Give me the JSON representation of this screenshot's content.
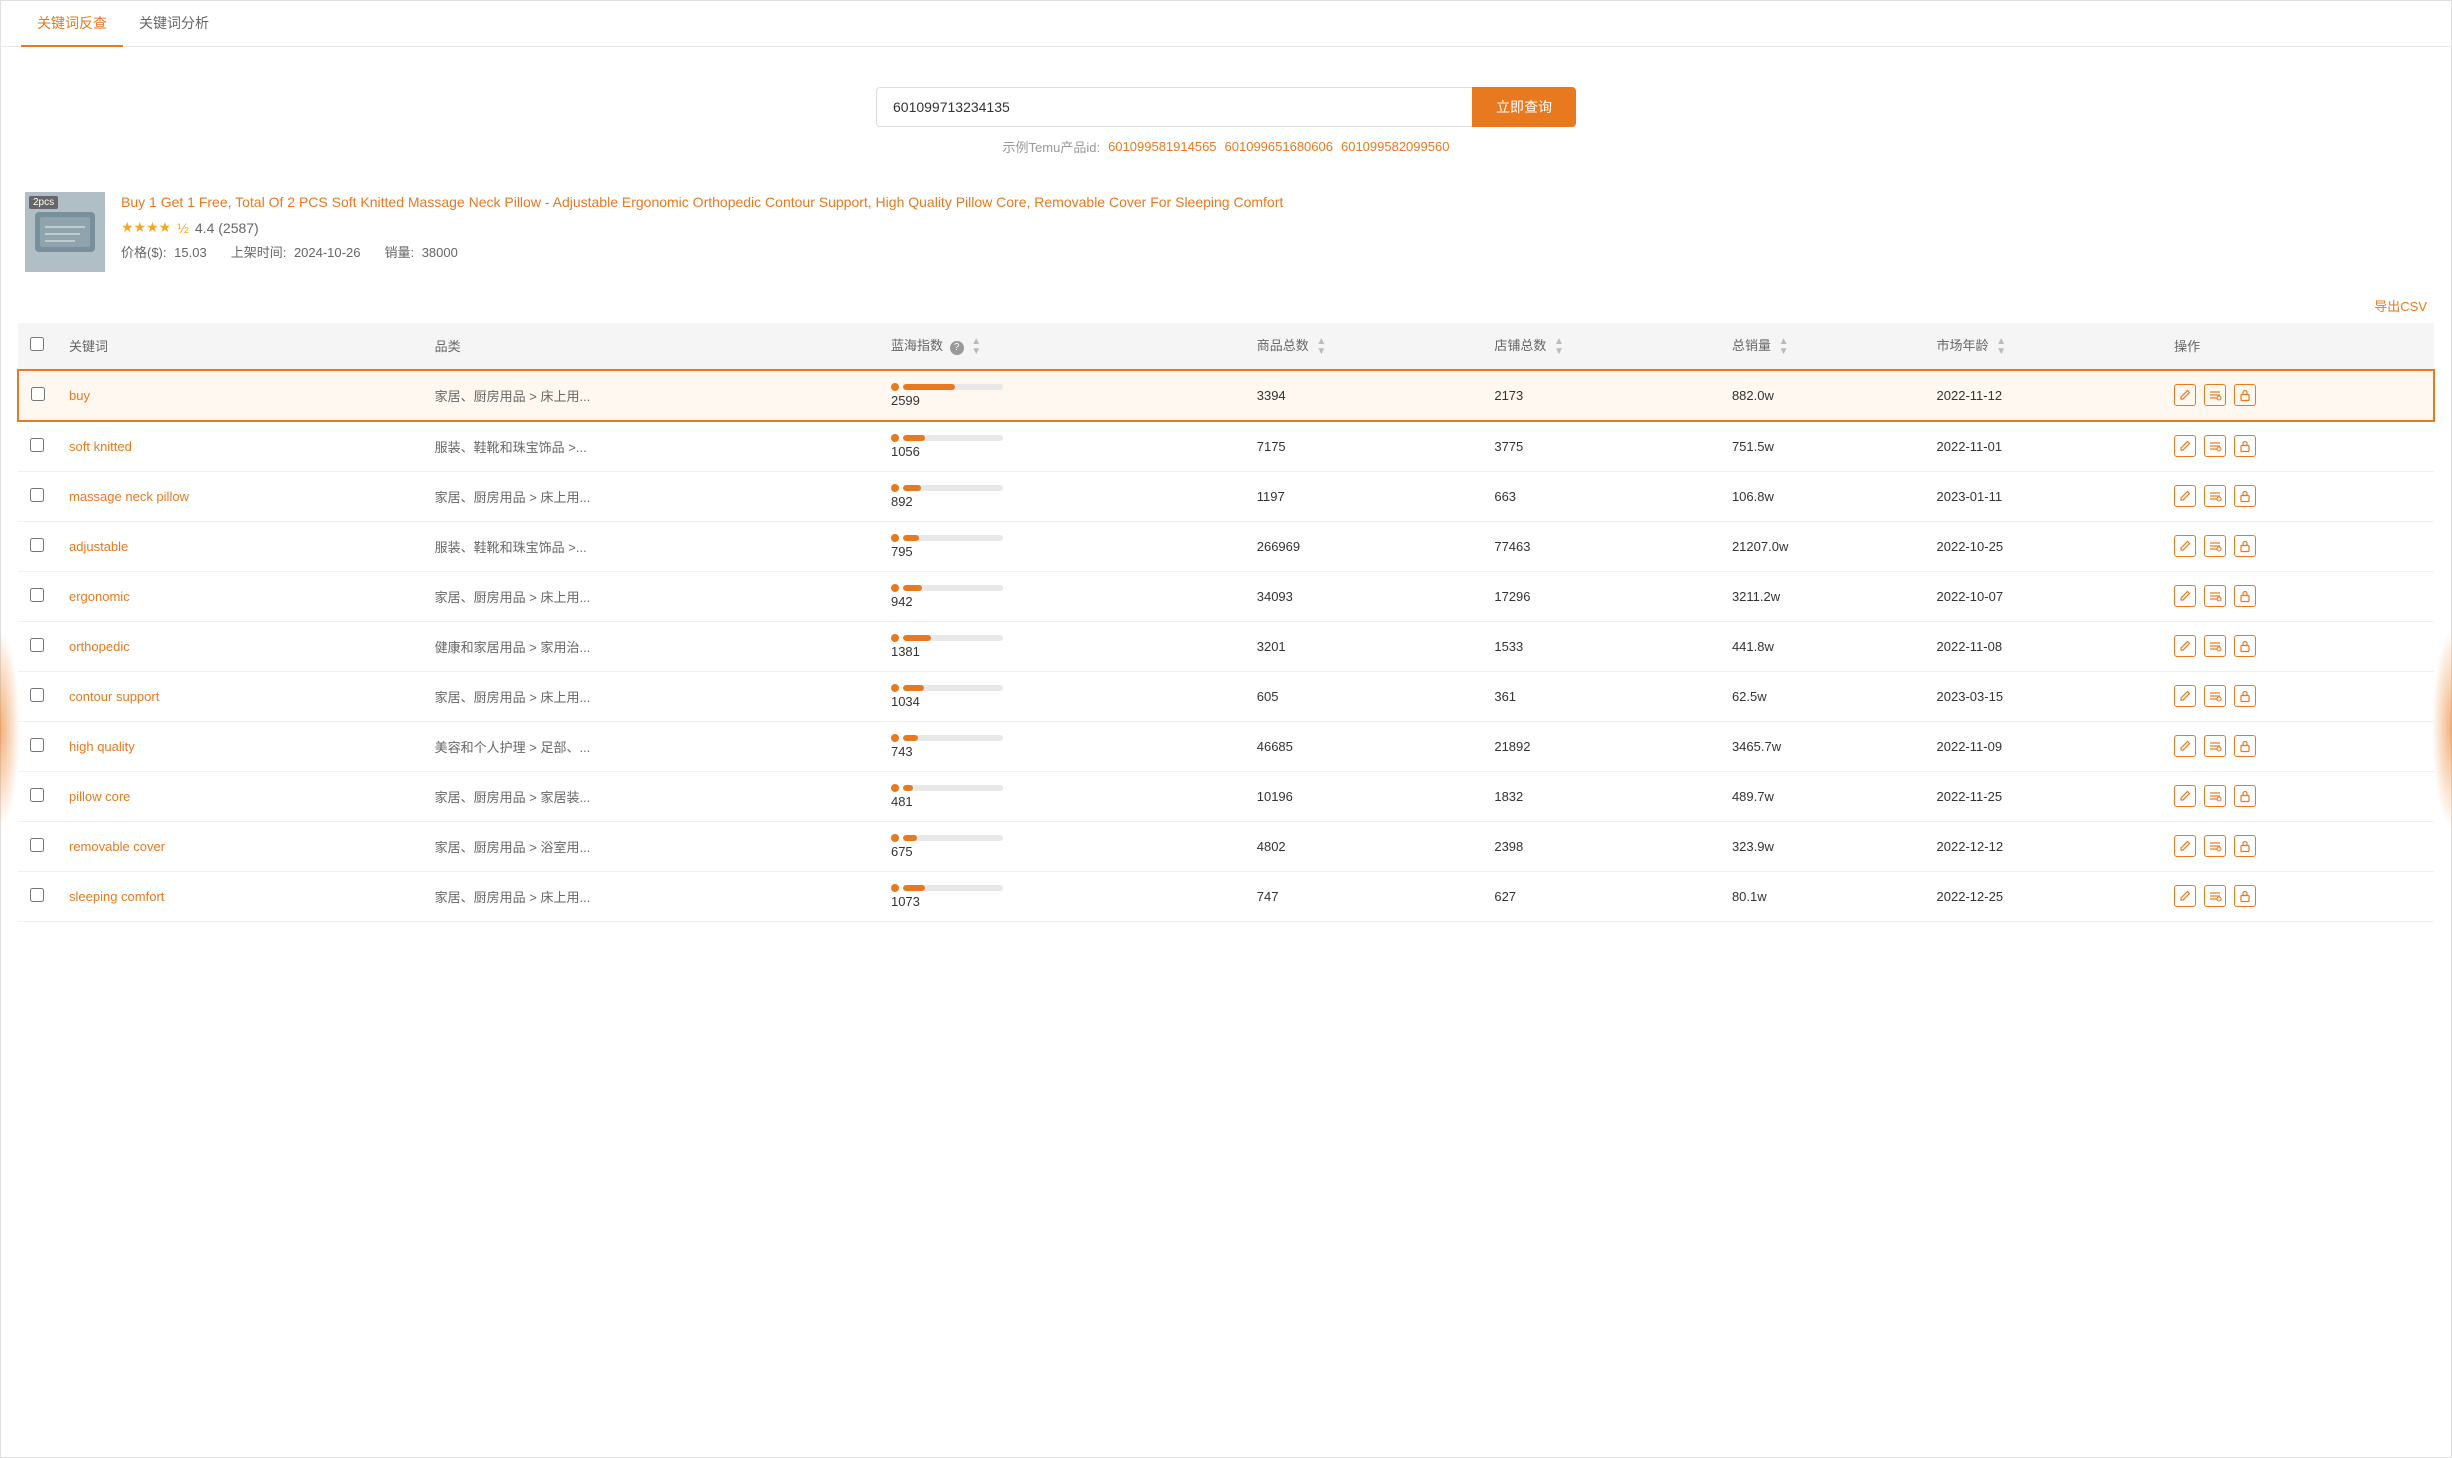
{
  "tabs": [
    {
      "id": "keyword-reverse",
      "label": "关键词反查",
      "active": true
    },
    {
      "id": "keyword-analysis",
      "label": "关键词分析",
      "active": false
    }
  ],
  "search": {
    "placeholder": "601099713234135",
    "button_label": "立即查询",
    "hint_label": "示例Temu产品id:",
    "example_ids": [
      "601099581914565",
      "601099651680606",
      "601099582099560"
    ]
  },
  "product": {
    "image_label": "2pcs",
    "title": "Buy 1 Get 1 Free, Total Of 2 PCS Soft Knitted Massage Neck Pillow - Adjustable Ergonomic Orthopedic Contour Support, High Quality Pillow Core, Removable Cover For Sleeping Comfort",
    "rating_stars": 4.4,
    "rating_count": "2587",
    "rating_display": "4.4 (2587)",
    "price_label": "价格($):",
    "price": "15.03",
    "shelf_label": "上架时间:",
    "shelf_date": "2024-10-26",
    "sales_label": "销量:",
    "sales": "38000"
  },
  "table": {
    "export_label": "导出CSV",
    "columns": [
      {
        "id": "checkbox",
        "label": ""
      },
      {
        "id": "keyword",
        "label": "关键词",
        "sortable": false
      },
      {
        "id": "category",
        "label": "品类",
        "sortable": false
      },
      {
        "id": "blue_ocean",
        "label": "蓝海指数",
        "sortable": true,
        "has_info": true
      },
      {
        "id": "total_products",
        "label": "商品总数",
        "sortable": true
      },
      {
        "id": "total_shops",
        "label": "店铺总数",
        "sortable": true
      },
      {
        "id": "total_sales",
        "label": "总销量",
        "sortable": true
      },
      {
        "id": "market_age",
        "label": "市场年龄",
        "sortable": true
      },
      {
        "id": "actions",
        "label": "操作",
        "sortable": false
      }
    ],
    "rows": [
      {
        "keyword": "buy",
        "category": "家居、厨房用品 > 床上用...",
        "blue_ocean": 2599,
        "blue_ocean_pct": 52,
        "total_products": 3394,
        "total_shops": 2173,
        "total_sales": "882.0w",
        "market_age": "2022-11-12",
        "highlight": true
      },
      {
        "keyword": "soft knitted",
        "category": "服装、鞋靴和珠宝饰品 >...",
        "blue_ocean": 1056,
        "blue_ocean_pct": 22,
        "total_products": 7175,
        "total_shops": 3775,
        "total_sales": "751.5w",
        "market_age": "2022-11-01",
        "highlight": false
      },
      {
        "keyword": "massage neck pillow",
        "category": "家居、厨房用品 > 床上用...",
        "blue_ocean": 892,
        "blue_ocean_pct": 18,
        "total_products": 1197,
        "total_shops": 663,
        "total_sales": "106.8w",
        "market_age": "2023-01-11",
        "highlight": false
      },
      {
        "keyword": "adjustable",
        "category": "服装、鞋靴和珠宝饰品 >...",
        "blue_ocean": 795,
        "blue_ocean_pct": 16,
        "total_products": 266969,
        "total_shops": 77463,
        "total_sales": "21207.0w",
        "market_age": "2022-10-25",
        "highlight": false
      },
      {
        "keyword": "ergonomic",
        "category": "家居、厨房用品 > 床上用...",
        "blue_ocean": 942,
        "blue_ocean_pct": 19,
        "total_products": 34093,
        "total_shops": 17296,
        "total_sales": "3211.2w",
        "market_age": "2022-10-07",
        "highlight": false
      },
      {
        "keyword": "orthopedic",
        "category": "健康和家居用品 > 家用治...",
        "blue_ocean": 1381,
        "blue_ocean_pct": 28,
        "total_products": 3201,
        "total_shops": 1533,
        "total_sales": "441.8w",
        "market_age": "2022-11-08",
        "highlight": false
      },
      {
        "keyword": "contour support",
        "category": "家居、厨房用品 > 床上用...",
        "blue_ocean": 1034,
        "blue_ocean_pct": 21,
        "total_products": 605,
        "total_shops": 361,
        "total_sales": "62.5w",
        "market_age": "2023-03-15",
        "highlight": false
      },
      {
        "keyword": "high quality",
        "category": "美容和个人护理 > 足部、...",
        "blue_ocean": 743,
        "blue_ocean_pct": 15,
        "total_products": 46685,
        "total_shops": 21892,
        "total_sales": "3465.7w",
        "market_age": "2022-11-09",
        "highlight": false
      },
      {
        "keyword": "pillow core",
        "category": "家居、厨房用品 > 家居装...",
        "blue_ocean": 481,
        "blue_ocean_pct": 10,
        "total_products": 10196,
        "total_shops": 1832,
        "total_sales": "489.7w",
        "market_age": "2022-11-25",
        "highlight": false
      },
      {
        "keyword": "removable cover",
        "category": "家居、厨房用品 > 浴室用...",
        "blue_ocean": 675,
        "blue_ocean_pct": 14,
        "total_products": 4802,
        "total_shops": 2398,
        "total_sales": "323.9w",
        "market_age": "2022-12-12",
        "highlight": false
      },
      {
        "keyword": "sleeping comfort",
        "category": "家居、厨房用品 > 床上用...",
        "blue_ocean": 1073,
        "blue_ocean_pct": 22,
        "total_products": 747,
        "total_shops": 627,
        "total_sales": "80.1w",
        "market_age": "2022-12-25",
        "highlight": false
      }
    ]
  },
  "icons": {
    "edit": "✏",
    "search": "≡",
    "lock": "🔒",
    "sort_up": "▲",
    "sort_down": "▼"
  }
}
